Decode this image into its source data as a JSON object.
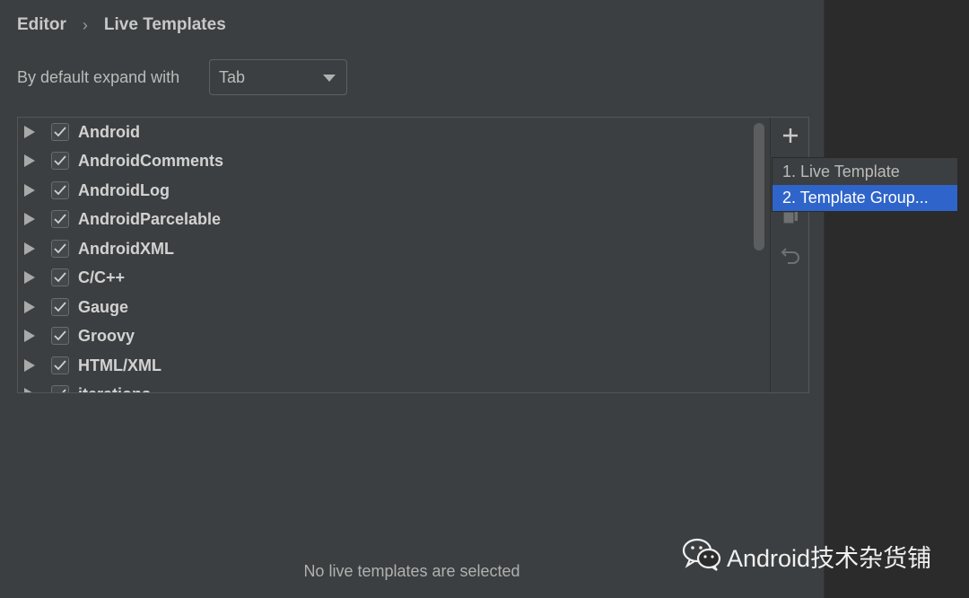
{
  "breadcrumb": {
    "parent": "Editor",
    "separator": "›",
    "current": "Live Templates"
  },
  "expand": {
    "label": "By default expand with",
    "value": "Tab"
  },
  "templates": [
    {
      "label": "Android",
      "checked": true
    },
    {
      "label": "AndroidComments",
      "checked": true
    },
    {
      "label": "AndroidLog",
      "checked": true
    },
    {
      "label": "AndroidParcelable",
      "checked": true
    },
    {
      "label": "AndroidXML",
      "checked": true
    },
    {
      "label": "C/C++",
      "checked": true
    },
    {
      "label": "Gauge",
      "checked": true
    },
    {
      "label": "Groovy",
      "checked": true
    },
    {
      "label": "HTML/XML",
      "checked": true
    },
    {
      "label": "iterations",
      "checked": true
    }
  ],
  "toolbar": {
    "add_icon": "plus-icon",
    "copy_icon": "copy-icon",
    "revert_icon": "undo-icon"
  },
  "popup": {
    "items": [
      {
        "label": "1. Live Template",
        "selected": false
      },
      {
        "label": "2. Template Group...",
        "selected": true
      }
    ]
  },
  "status": {
    "empty_message": "No live templates are selected"
  },
  "watermark": {
    "text": "Android技术杂货铺",
    "icon": "wechat-icon"
  },
  "colors": {
    "panel": "#3c3f41",
    "background": "#2b2b2b",
    "selection": "#2f65ca",
    "text": "#bbbbbb"
  }
}
